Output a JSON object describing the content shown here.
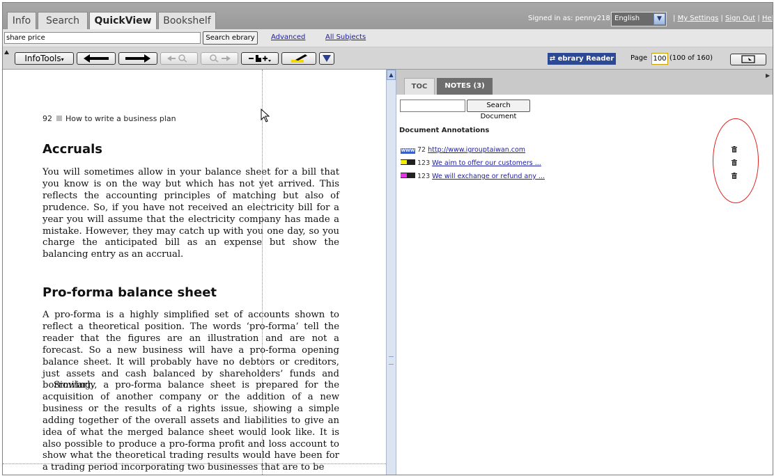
{
  "tabs": [
    {
      "label": "Info",
      "active": false
    },
    {
      "label": "Search",
      "active": false
    },
    {
      "label": "QuickView",
      "active": true
    },
    {
      "label": "Bookshelf",
      "active": false
    }
  ],
  "header": {
    "signed_in": "Signed in as: penny218",
    "language": "English",
    "links": [
      "My Settings",
      "Sign Out",
      "Help"
    ]
  },
  "search": {
    "query": "share price",
    "button": "Search ebrary",
    "advanced": "Advanced",
    "all_subjects": "All Subjects"
  },
  "toolbar": {
    "infotools": "InfoTools",
    "buttons": [
      "back-arrow",
      "forward-arrow",
      "search-previous",
      "search-next",
      "page-add",
      "highlighter",
      "more-down"
    ],
    "reader_label": "ebrary Reader",
    "page_label": "Page",
    "page_value": "100",
    "page_count": "(100 of 160)"
  },
  "document": {
    "running_head_number": "92",
    "running_head_text": "How to write a business plan",
    "section1_title": "Accruals",
    "section1_body": "You will sometimes allow in your balance sheet for a bill that you know is on the way but which has not yet arrived. This reflects the accounting principles of matching but also of prudence. So, if you have not received an electricity bill for a year you will assume that the electricity company has made a mistake. However, they may catch up with you one day, so you charge the anticipated bill as an expense but show the balancing entry as an accrual.",
    "section2_title": "Pro-forma balance sheet",
    "section2_body1": "A pro-forma is a highly simplified set of accounts shown to reflect a theoretical position. The words ‘pro-forma’ tell the reader that the figures are an illustration and are not a forecast. So a new business will have a pro-forma opening balance sheet. It will probably have no debtors or creditors, just assets and cash balanced by shareholders’ funds and borrowing.",
    "section2_body2": "Similarly, a pro-forma balance sheet is prepared for the acquisition of another company or the addition of a new business or the results of a rights issue, showing a simple adding together of the overall assets and liabilities to give an idea of what the merged balance sheet would look like. It is also possible to produce a pro-forma profit and loss account to show what the theoretical trading results would have been for a trading period incorporating two businesses that are to be"
  },
  "sidebar": {
    "tab_toc": "TOC",
    "tab_notes": "NOTES (3)",
    "search_button": "Search Document",
    "annotations_title": "Document Annotations",
    "annotations": [
      {
        "type": "link",
        "page": "72",
        "text": "http://www.igrouptaiwan.com",
        "color": "#3a5fc8"
      },
      {
        "type": "highlight",
        "page": "123",
        "text": "We aim to offer our customers ...",
        "color": "#f2ee00"
      },
      {
        "type": "highlight",
        "page": "123",
        "text": "We will exchange or refund any ...",
        "color": "#e633e6"
      }
    ]
  },
  "colors": {
    "topbar": "#a0a0a0",
    "reader_button": "#2b4a93",
    "annotation_circle": "#e0201a",
    "link": "#1a1aa8"
  }
}
